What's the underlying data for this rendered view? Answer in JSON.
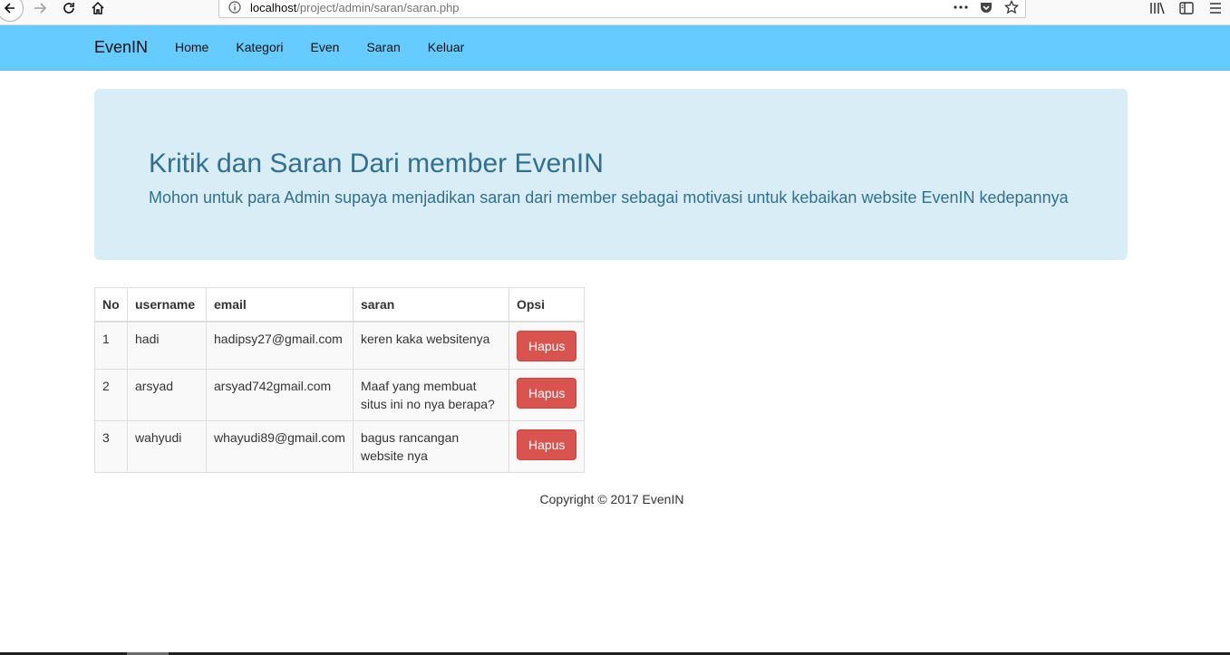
{
  "browser": {
    "url_host": "localhost",
    "url_path": "/project/admin/saran/saran.php",
    "icons": [
      "back-icon",
      "forward-icon",
      "reload-icon",
      "home-icon",
      "info-icon",
      "more-icon",
      "pocket-icon",
      "bookmark-star-icon",
      "library-icon",
      "sidebar-icon",
      "menu-icon"
    ]
  },
  "navbar": {
    "brand": "EvenIN",
    "links": [
      "Home",
      "Kategori",
      "Even",
      "Saran",
      "Keluar"
    ],
    "background": "#66ccff"
  },
  "jumbotron": {
    "title": "Kritik dan Saran Dari member EvenIN",
    "subtitle": "Mohon untuk para Admin supaya menjadikan saran dari member sebagai motivasi untuk kebaikan website EvenIN kedepannya"
  },
  "table": {
    "headers": [
      "No",
      "username",
      "email",
      "saran",
      "Opsi"
    ],
    "rows": [
      {
        "no": "1",
        "username": "hadi",
        "email": "hadipsy27@gmail.com",
        "saran": "keren kaka websitenya",
        "action": "Hapus"
      },
      {
        "no": "2",
        "username": "arsyad",
        "email": "arsyad742gmail.com",
        "saran": "Maaf yang membuat situs ini no nya berapa?",
        "action": "Hapus"
      },
      {
        "no": "3",
        "username": "wahyudi",
        "email": "whayudi89@gmail.com",
        "saran": "bagus rancangan website nya",
        "action": "Hapus"
      }
    ]
  },
  "footer": {
    "text": "Copyright © 2017 EvenIN"
  },
  "colors": {
    "accent": "#66ccff",
    "jumbotron_bg": "#d9edf7",
    "jumbotron_text": "#31708f",
    "danger": "#d9534f"
  }
}
